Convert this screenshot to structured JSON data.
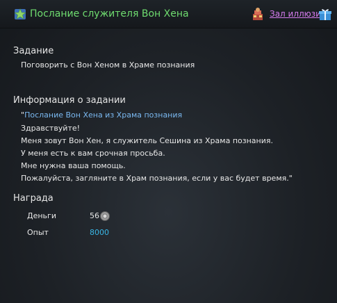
{
  "header": {
    "title": "Послание служителя Вон Хена",
    "location_link": "Зал иллюзий",
    "icons": {
      "quest": "quest-star-icon",
      "npc": "npc-icon",
      "gift": "gift-box-icon"
    }
  },
  "task": {
    "heading": "Задание",
    "description": "Поговорить с Вон Хеном в Храме познания"
  },
  "info": {
    "heading": "Информация о задании",
    "quote_open": "\"",
    "quote_title": "Послание Вон Хена из Храма познания",
    "lines": [
      "Здравствуйте!",
      "Меня зовут Вон Хен, я служитель Сешина из Храма познания.",
      "У меня есть к вам срочная просьба.",
      "Мне нужна ваша помощь.",
      "Пожалуйста, загляните в Храм познания, если у вас будет время.\""
    ]
  },
  "reward": {
    "heading": "Награда",
    "money_label": "Деньги",
    "money_value": "56",
    "money_icon": "silver-coin-icon",
    "exp_label": "Опыт",
    "exp_value": "8000"
  },
  "colors": {
    "title_green": "#6fdc6f",
    "link_purple": "#d77df0",
    "quote_blue": "#7ab8f0",
    "exp_cyan": "#39b7e6"
  }
}
